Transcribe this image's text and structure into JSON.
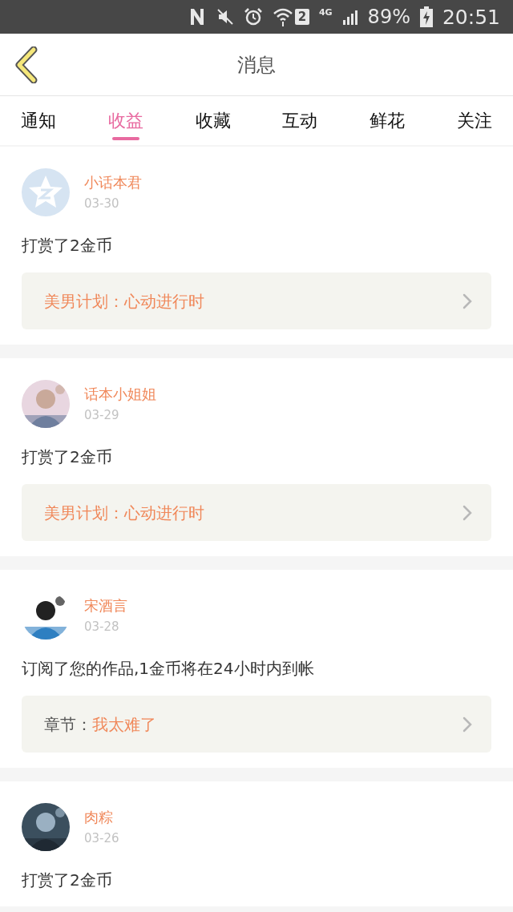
{
  "status_bar": {
    "network": "4G",
    "sim": "2",
    "battery": "89%",
    "time": "20:51"
  },
  "header": {
    "title": "消息"
  },
  "tabs": [
    {
      "label": "通知",
      "selected": false
    },
    {
      "label": "收益",
      "selected": true
    },
    {
      "label": "收藏",
      "selected": false
    },
    {
      "label": "互动",
      "selected": false
    },
    {
      "label": "鲜花",
      "selected": false
    },
    {
      "label": "关注",
      "selected": false
    }
  ],
  "messages": [
    {
      "avatar": {
        "kind": "default"
      },
      "name": "小话本君",
      "date": "03-30",
      "text": "打赏了2金币",
      "link": {
        "label": "美男计划：",
        "title": "心动进行时",
        "label_accent": true
      }
    },
    {
      "name": "话本小姐姐",
      "date": "03-29",
      "text": "打赏了2金币",
      "link": {
        "label": "美男计划：",
        "title": "心动进行时",
        "label_accent": true
      }
    },
    {
      "name": "宋酒言",
      "date": "03-28",
      "text": "订阅了您的作品,1金币将在24小时内到帐",
      "link": {
        "label": "章节：",
        "title": "我太难了",
        "label_accent": false
      }
    },
    {
      "name": "肉粽",
      "date": "03-26",
      "text": "打赏了2金币"
    }
  ]
}
